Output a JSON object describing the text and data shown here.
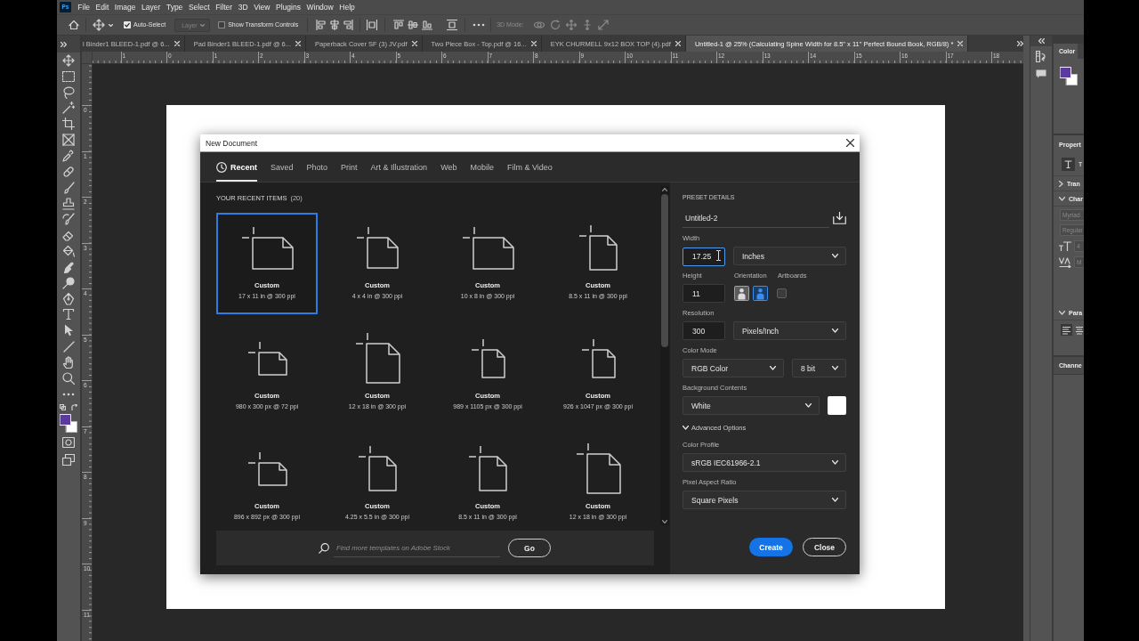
{
  "app": {
    "logo": "Ps"
  },
  "menu_bar": [
    "File",
    "Edit",
    "Image",
    "Layer",
    "Type",
    "Select",
    "Filter",
    "3D",
    "View",
    "Plugins",
    "Window",
    "Help"
  ],
  "options_bar": {
    "auto_select": {
      "label": "Auto-Select",
      "checked": true
    },
    "target": {
      "value": "Layer",
      "disabled": true
    },
    "transform_controls": {
      "label": "Show Transform Controls",
      "checked": false
    },
    "mode_3d": {
      "label": "3D Mode:",
      "disabled": true
    }
  },
  "document_tabs": [
    {
      "title": "l Binder1 BLEED-1.pdf @ 6...",
      "selected": false
    },
    {
      "title": "Pad Binder1 BLEED-1.pdf @ 6...",
      "selected": false
    },
    {
      "title": "Paperback Cover SF (3) JV.pdf",
      "selected": false
    },
    {
      "title": "Two Piece Box - Top.pdf @ 16...",
      "selected": false
    },
    {
      "title": "EYK CHURMELL 9x12 BOX TOP (4).pdf",
      "selected": false
    },
    {
      "title": "Untitled-1 @ 25% (Calculating Spine Width for 8.5\" x 11\" Perfect Bound Book, RGB/8) *",
      "selected": true
    }
  ],
  "rulers": {
    "horizontal": [
      "1",
      "0",
      "1",
      "2",
      "3",
      "4",
      "5",
      "6",
      "7",
      "8",
      "9",
      "10",
      "11",
      "12",
      "13",
      "14",
      "15",
      "16",
      "17",
      "18"
    ],
    "vertical": [
      "0",
      "1",
      "2",
      "3",
      "4",
      "5",
      "6",
      "7",
      "8",
      "9",
      "10",
      "11"
    ]
  },
  "color_swatches": [
    {
      "color": "#5b3b9b"
    },
    {
      "color": "#ffffff"
    }
  ],
  "new_document": {
    "title": "New Document",
    "tabs": [
      {
        "label": "Recent",
        "kind": "recent",
        "selected": true
      },
      {
        "label": "Saved",
        "kind": "category",
        "selected": false
      },
      {
        "label": "Photo",
        "kind": "category",
        "selected": false
      },
      {
        "label": "Print",
        "kind": "category",
        "selected": false
      },
      {
        "label": "Art & Illustration",
        "kind": "category",
        "selected": false
      },
      {
        "label": "Web",
        "kind": "category",
        "selected": false
      },
      {
        "label": "Mobile",
        "kind": "category",
        "selected": false
      },
      {
        "label": "Film & Video",
        "kind": "category",
        "selected": false
      }
    ],
    "recent": {
      "heading": "YOUR RECENT ITEMS",
      "count": "(20)",
      "items": [
        {
          "name": "Custom",
          "size": "17 x 11 in @ 300 ppi",
          "kind": "landscape",
          "selected": true
        },
        {
          "name": "Custom",
          "size": "4 x 4 in @ 300 ppi",
          "kind": "square",
          "selected": false
        },
        {
          "name": "Custom",
          "size": "10 x 8 in @ 300 ppi",
          "kind": "landscape",
          "selected": false
        },
        {
          "name": "Custom",
          "size": "8.5 x 11 in @ 300 ppi",
          "kind": "portrait",
          "selected": false
        },
        {
          "name": "Custom",
          "size": "980 x 300 px @ 72 ppi",
          "kind": "smallwide",
          "selected": false
        },
        {
          "name": "Custom",
          "size": "12 x 18 in @ 300 ppi",
          "kind": "tall",
          "selected": false
        },
        {
          "name": "Custom",
          "size": "989 x 1105 px @ 300 ppi",
          "kind": "smalltall",
          "selected": false
        },
        {
          "name": "Custom",
          "size": "926 x 1047 px @ 300 ppi",
          "kind": "smalltall",
          "selected": false
        },
        {
          "name": "Custom",
          "size": "896 x 892 px @ 300 ppi",
          "kind": "smallwide",
          "selected": false
        },
        {
          "name": "Custom",
          "size": "4.25 x 5.5 in @ 300 ppi",
          "kind": "portrait",
          "selected": false
        },
        {
          "name": "Custom",
          "size": "8.5 x 11 in @ 300 ppi",
          "kind": "portrait",
          "selected": false
        },
        {
          "name": "Custom",
          "size": "12 x 18 in @ 300 ppi",
          "kind": "tall",
          "selected": false
        }
      ]
    },
    "search": {
      "placeholder": "Find more templates on Adobe Stock",
      "button": "Go"
    },
    "preset": {
      "heading": "PRESET DETAILS",
      "name": "Untitled-2",
      "width": {
        "label": "Width",
        "value": "17.25",
        "unit": "Inches",
        "focused": true
      },
      "height": {
        "label": "Height",
        "value": "11"
      },
      "orientation": {
        "label": "Orientation",
        "options": [
          {
            "selected": false
          },
          {
            "selected": true
          }
        ]
      },
      "artboards": {
        "label": "Artboards",
        "checked": false
      },
      "resolution": {
        "label": "Resolution",
        "value": "300",
        "unit": "Pixels/Inch"
      },
      "color_mode": {
        "label": "Color Mode",
        "value": "RGB Color",
        "depth": "8 bit"
      },
      "background_contents": {
        "label": "Background Contents",
        "value": "White",
        "color": "#ffffff"
      },
      "advanced_options": {
        "label": "Advanced Options",
        "expanded": true
      },
      "color_profile": {
        "label": "Color Profile",
        "value": "sRGB IEC61966-2.1"
      },
      "pixel_aspect_ratio": {
        "label": "Pixel Aspect Ratio",
        "value": "Square Pixels"
      }
    },
    "buttons": [
      {
        "label": "Create",
        "kind": "primary"
      },
      {
        "label": "Close",
        "kind": "secondary"
      }
    ]
  },
  "panels": {
    "color": {
      "tab": "Color"
    },
    "properties": {
      "title": "Propert",
      "layer_kind": "T",
      "transform": {
        "title": "Tran",
        "expanded": false
      },
      "character": {
        "title": "Char",
        "expanded": true,
        "font": "Myriad",
        "style": "Regular",
        "size": "4",
        "tracking": "M"
      },
      "paragraph": {
        "title": "Para",
        "expanded": true
      }
    },
    "channels": {
      "title": "Channe"
    }
  }
}
